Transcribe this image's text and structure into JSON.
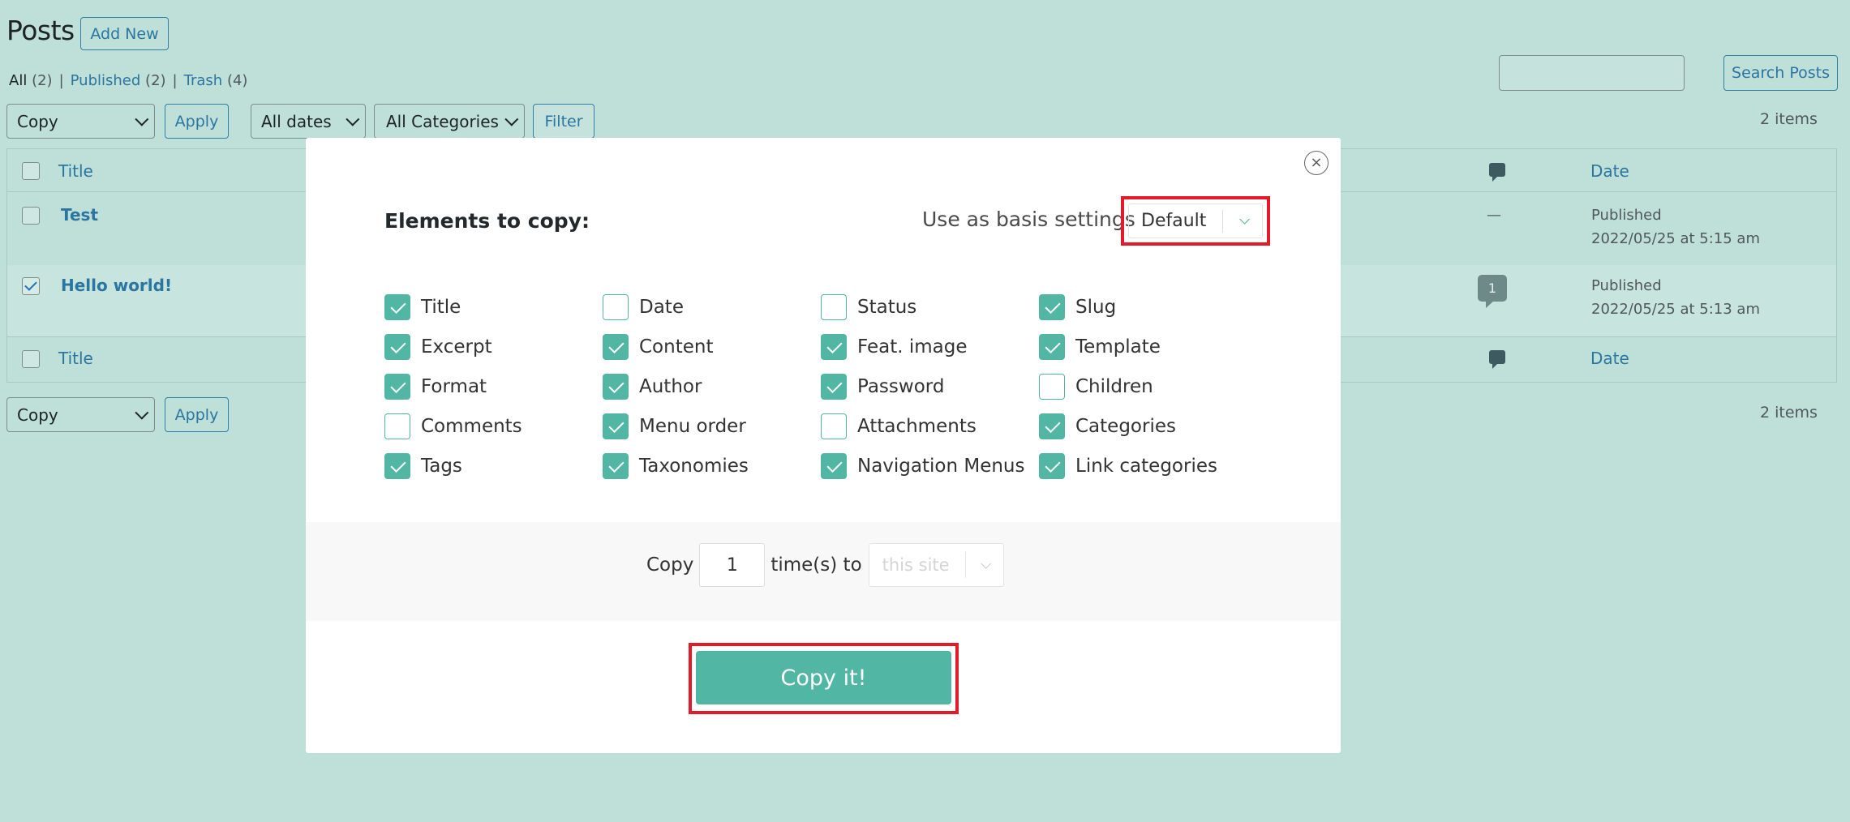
{
  "header": {
    "title": "Posts",
    "add_new": "Add New"
  },
  "views": {
    "all_label": "All",
    "all_count": "(2)",
    "published_label": "Published",
    "published_count": "(2)",
    "trash_label": "Trash",
    "trash_count": "(4)",
    "sep": "|"
  },
  "search": {
    "button": "Search Posts",
    "value": ""
  },
  "toolbar_top": {
    "bulk_action": "Copy",
    "apply": "Apply",
    "dates": "All dates",
    "categories": "All Categories",
    "filter": "Filter",
    "items": "2 items"
  },
  "table": {
    "col_title": "Title",
    "col_date": "Date",
    "rows": [
      {
        "title": "Test",
        "checked": false,
        "comments": "—",
        "status": "Published",
        "date": "2022/05/25 at 5:15 am"
      },
      {
        "title": "Hello world!",
        "checked": true,
        "comments": "1",
        "status": "Published",
        "date": "2022/05/25 at 5:13 am"
      }
    ]
  },
  "toolbar_bottom": {
    "bulk_action": "Copy",
    "apply": "Apply",
    "items": "2 items"
  },
  "modal": {
    "close": "×",
    "elements_title": "Elements to copy:",
    "basis_label": "Use as basis settings",
    "basis_value": "Default",
    "options": [
      {
        "label": "Title",
        "checked": true
      },
      {
        "label": "Date",
        "checked": false
      },
      {
        "label": "Status",
        "checked": false
      },
      {
        "label": "Slug",
        "checked": true
      },
      {
        "label": "Excerpt",
        "checked": true
      },
      {
        "label": "Content",
        "checked": true
      },
      {
        "label": "Feat. image",
        "checked": true
      },
      {
        "label": "Template",
        "checked": true
      },
      {
        "label": "Format",
        "checked": true
      },
      {
        "label": "Author",
        "checked": true
      },
      {
        "label": "Password",
        "checked": true
      },
      {
        "label": "Children",
        "checked": false
      },
      {
        "label": "Comments",
        "checked": false
      },
      {
        "label": "Menu order",
        "checked": true
      },
      {
        "label": "Attachments",
        "checked": false
      },
      {
        "label": "Categories",
        "checked": true
      },
      {
        "label": "Tags",
        "checked": true
      },
      {
        "label": "Taxonomies",
        "checked": true
      },
      {
        "label": "Navigation Menus",
        "checked": true
      },
      {
        "label": "Link categories",
        "checked": true
      }
    ],
    "copy_label": "Copy",
    "times_value": "1",
    "times_to_label": "time(s) to",
    "site_placeholder": "this site",
    "copy_button": "Copy it!"
  },
  "colors": {
    "accent": "#52b6a5",
    "highlight": "#e31a2a",
    "background": "#bfdfd9",
    "link": "#2a76a0"
  }
}
